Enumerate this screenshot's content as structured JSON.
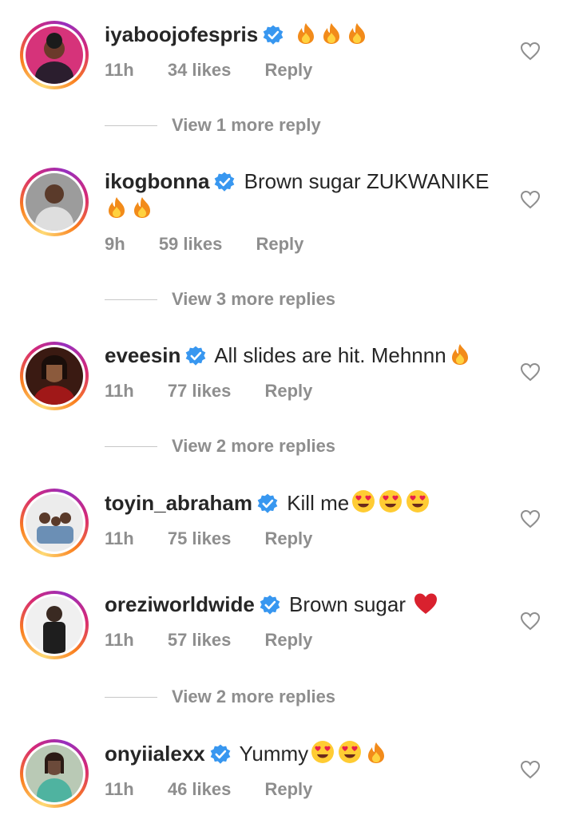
{
  "comments": [
    {
      "username": "iyaboojofespris",
      "text": "",
      "emojis": [
        "fire",
        "fire",
        "fire"
      ],
      "time": "11h",
      "likes": "34 likes",
      "reply": "Reply",
      "view_more": "View 1 more reply",
      "avatar_colors": [
        "#c2185b",
        "#3a2a2a"
      ]
    },
    {
      "username": "ikogbonna",
      "text": "Brown sugar ZUKWANIKE",
      "emojis": [
        "fire",
        "fire"
      ],
      "time": "9h",
      "likes": "59 likes",
      "reply": "Reply",
      "view_more": "View 3 more replies",
      "avatar_colors": [
        "#8a8a8a",
        "#cfcfcf"
      ]
    },
    {
      "username": "eveesin",
      "text": "All slides are hit. Mehnnn",
      "emojis": [
        "fire"
      ],
      "time": "11h",
      "likes": "77 likes",
      "reply": "Reply",
      "view_more": "View 2 more replies",
      "avatar_colors": [
        "#7a1010",
        "#2a1510"
      ]
    },
    {
      "username": "toyin_abraham",
      "text": "Kill me",
      "emojis": [
        "heart-eyes",
        "heart-eyes",
        "heart-eyes"
      ],
      "time": "11h",
      "likes": "75 likes",
      "reply": "Reply",
      "view_more": "",
      "avatar_colors": [
        "#e9e9e9",
        "#6b8fb5"
      ]
    },
    {
      "username": "oreziworldwide",
      "text": "Brown sugar",
      "emojis": [
        "red-heart"
      ],
      "time": "11h",
      "likes": "57 likes",
      "reply": "Reply",
      "view_more": "View 2 more replies",
      "avatar_colors": [
        "#f2f2f2",
        "#222222"
      ]
    },
    {
      "username": "onyiialexx",
      "text": "Yummy",
      "emojis": [
        "heart-eyes",
        "heart-eyes",
        "fire"
      ],
      "time": "11h",
      "likes": "46 likes",
      "reply": "Reply",
      "view_more": "",
      "avatar_colors": [
        "#4fb3a0",
        "#6b4a3a"
      ]
    }
  ],
  "colors": {
    "verified_badge": "#3897f0",
    "meta_text": "#8e8e8e",
    "primary_text": "#262626",
    "story_ring": [
      "#feda75",
      "#fa7e1e",
      "#d62976",
      "#962fbf"
    ]
  },
  "icons": {
    "like": "heart-outline-icon",
    "verified": "verified-badge-icon"
  }
}
